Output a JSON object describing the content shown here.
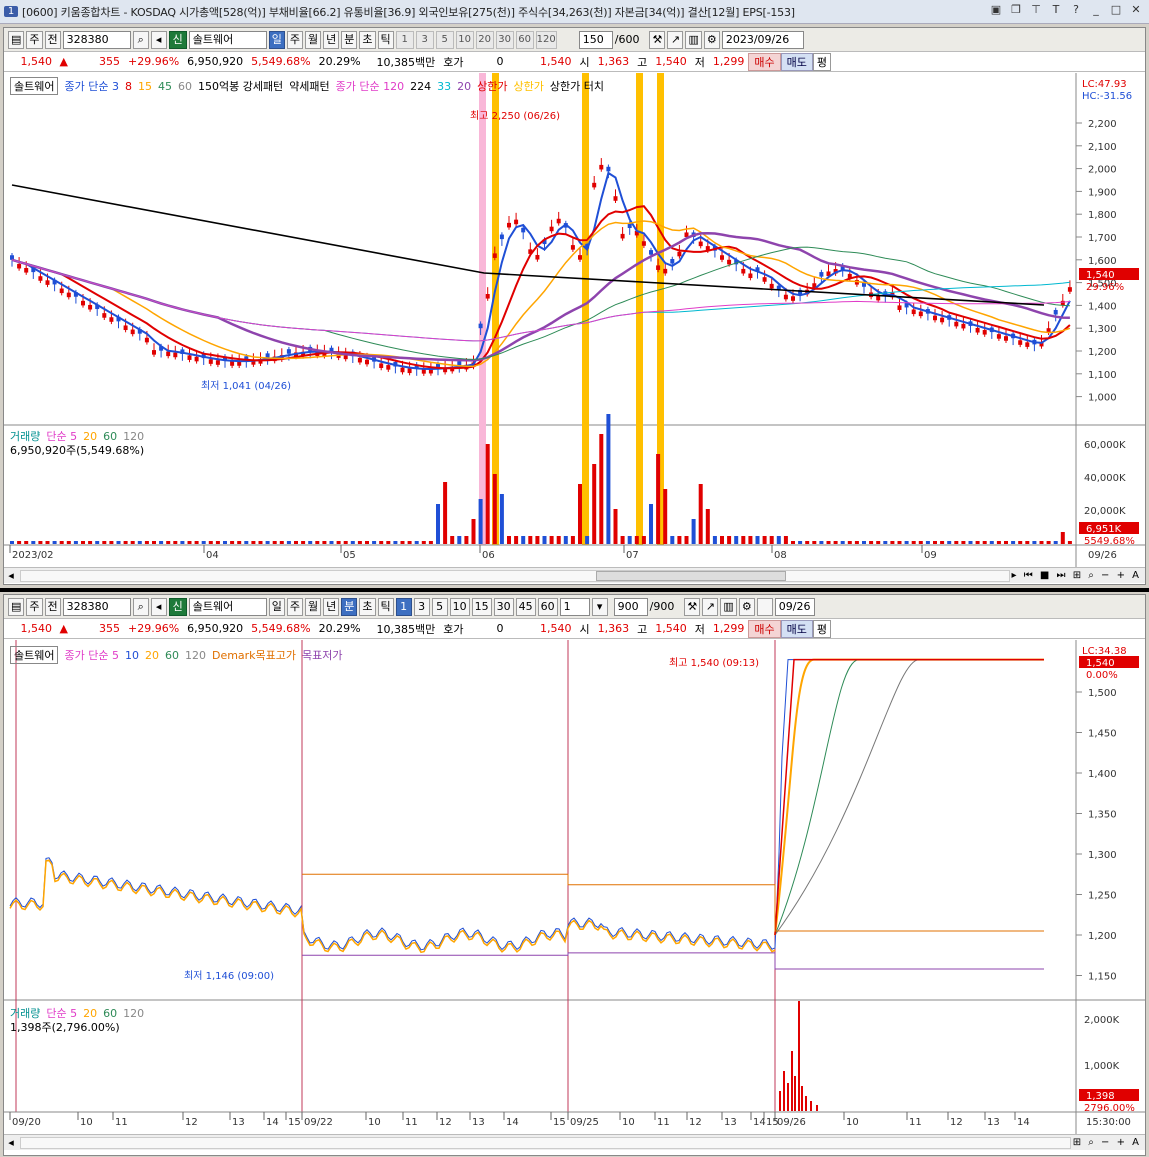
{
  "window": {
    "num": "1",
    "title": "[0600] 키움종합차트 - KOSDAQ 시가총액[528(억)] 부채비율[66.2] 유통비율[36.9] 외국인보유[275(천)] 주식수[34,263(천)] 자본금[34(억)] 결산[12월] EPS[-153]"
  },
  "top": {
    "toolbar": {
      "type1": "주",
      "type2": "전",
      "code": "328380",
      "badge": "신",
      "name": "솔트웨어",
      "periods": [
        "일",
        "주",
        "월",
        "년",
        "분",
        "초",
        "틱"
      ],
      "active_period": "일",
      "nums": [
        "1",
        "3",
        "5",
        "10",
        "20",
        "30",
        "60",
        "120"
      ],
      "count": "150",
      "count_total": "/600",
      "date": "2023/09/26"
    },
    "info": {
      "price": "1,540",
      "change": "355",
      "rate": "+29.96%",
      "volume": "6,950,920",
      "volrate": "5,549.68%",
      "turnover": "20.29%",
      "amount": "10,385백만",
      "hoga_label": "호가",
      "hoga": "0",
      "last": "1,540",
      "open_label": "시",
      "open": "1,363",
      "high_label": "고",
      "high": "1,540",
      "low_label": "저",
      "low": "1,299",
      "buy": "매수",
      "sell": "매도",
      "flat": "평"
    },
    "legend": [
      "솔트웨어",
      "종가 단순 3",
      "8",
      "15",
      "45",
      "60",
      "150억봉 강세패턴",
      "약세패턴",
      "종가 단순 120",
      "224",
      "33",
      "20",
      "상한가",
      "상한가",
      "상한가 터치"
    ],
    "lc": "LC:47.93",
    "hc": "HC:-31.56",
    "y_ticks": [
      "2,200",
      "2,100",
      "2,000",
      "1,900",
      "1,800",
      "1,700",
      "1,600",
      "1,500",
      "1,400",
      "1,300",
      "1,200",
      "1,100",
      "1,000"
    ],
    "last_price_tag": "1,540",
    "last_rate_tag": "29.96%",
    "high_label": "최고 2,250 (06/26)",
    "low_label": "최저 1,041 (04/26)",
    "vol_legend": [
      "거래량",
      "단순 5",
      "20",
      "60",
      "120"
    ],
    "vol_value": "6,950,920주(5,549.68%)",
    "vol_ticks": [
      "60,000K",
      "40,000K",
      "20,000K"
    ],
    "vol_tag": "6,951K",
    "vol_tag2": "5549.68%",
    "x_ticks": [
      "2023/02",
      "04",
      "05",
      "06",
      "07",
      "08",
      "09"
    ],
    "x_end": "09/26"
  },
  "bottom": {
    "toolbar": {
      "type1": "주",
      "type2": "전",
      "code": "328380",
      "badge": "신",
      "name": "솔트웨어",
      "periods": [
        "일",
        "주",
        "월",
        "년",
        "분",
        "초",
        "틱"
      ],
      "active_period": "분",
      "nums": [
        "1",
        "3",
        "5",
        "10",
        "15",
        "30",
        "45",
        "60"
      ],
      "unit": "1",
      "count": "900",
      "count_total": "/900",
      "date": "09/26"
    },
    "legend": [
      "솔트웨어",
      "종가 단순 5",
      "10",
      "20",
      "60",
      "120",
      "Demark목표고가",
      "목표저가"
    ],
    "lc": "LC:34.38",
    "last_price_tag": "1,540",
    "last_rate_tag": "0.00%",
    "y_ticks": [
      "1,500",
      "1,450",
      "1,400",
      "1,350",
      "1,300",
      "1,250",
      "1,200",
      "1,150"
    ],
    "high_label": "최고 1,540 (09:13)",
    "low_label": "최저 1,146 (09:00)",
    "vol_legend": [
      "거래량",
      "단순 5",
      "20",
      "60",
      "120"
    ],
    "vol_value": "1,398주(2,796.00%)",
    "vol_ticks": [
      "2,000K",
      "1,000K"
    ],
    "vol_tag": "1,398",
    "vol_tag2": "2796.00%",
    "x_ticks": [
      "09/20",
      "10",
      "11",
      "12",
      "13",
      "14",
      "15",
      "09/22",
      "10",
      "11",
      "12",
      "13",
      "14",
      "15",
      "09/25",
      "10",
      "11",
      "12",
      "13",
      "14",
      "15",
      "09/26",
      "10",
      "11",
      "12",
      "13",
      "14"
    ],
    "x_end": "15:30:00"
  },
  "colors": {
    "up": "#e00000",
    "down": "#1f4fd6",
    "ma3": "#1f4fd6",
    "ma8": "#e00000",
    "ma15": "#ffa500",
    "ma45": "#2e8b57",
    "ma60": "#8e44ad",
    "ma120": "#e03cc8",
    "ma224": "#000000",
    "limit": "#ffc000",
    "pink": "#f9b7d8"
  }
}
